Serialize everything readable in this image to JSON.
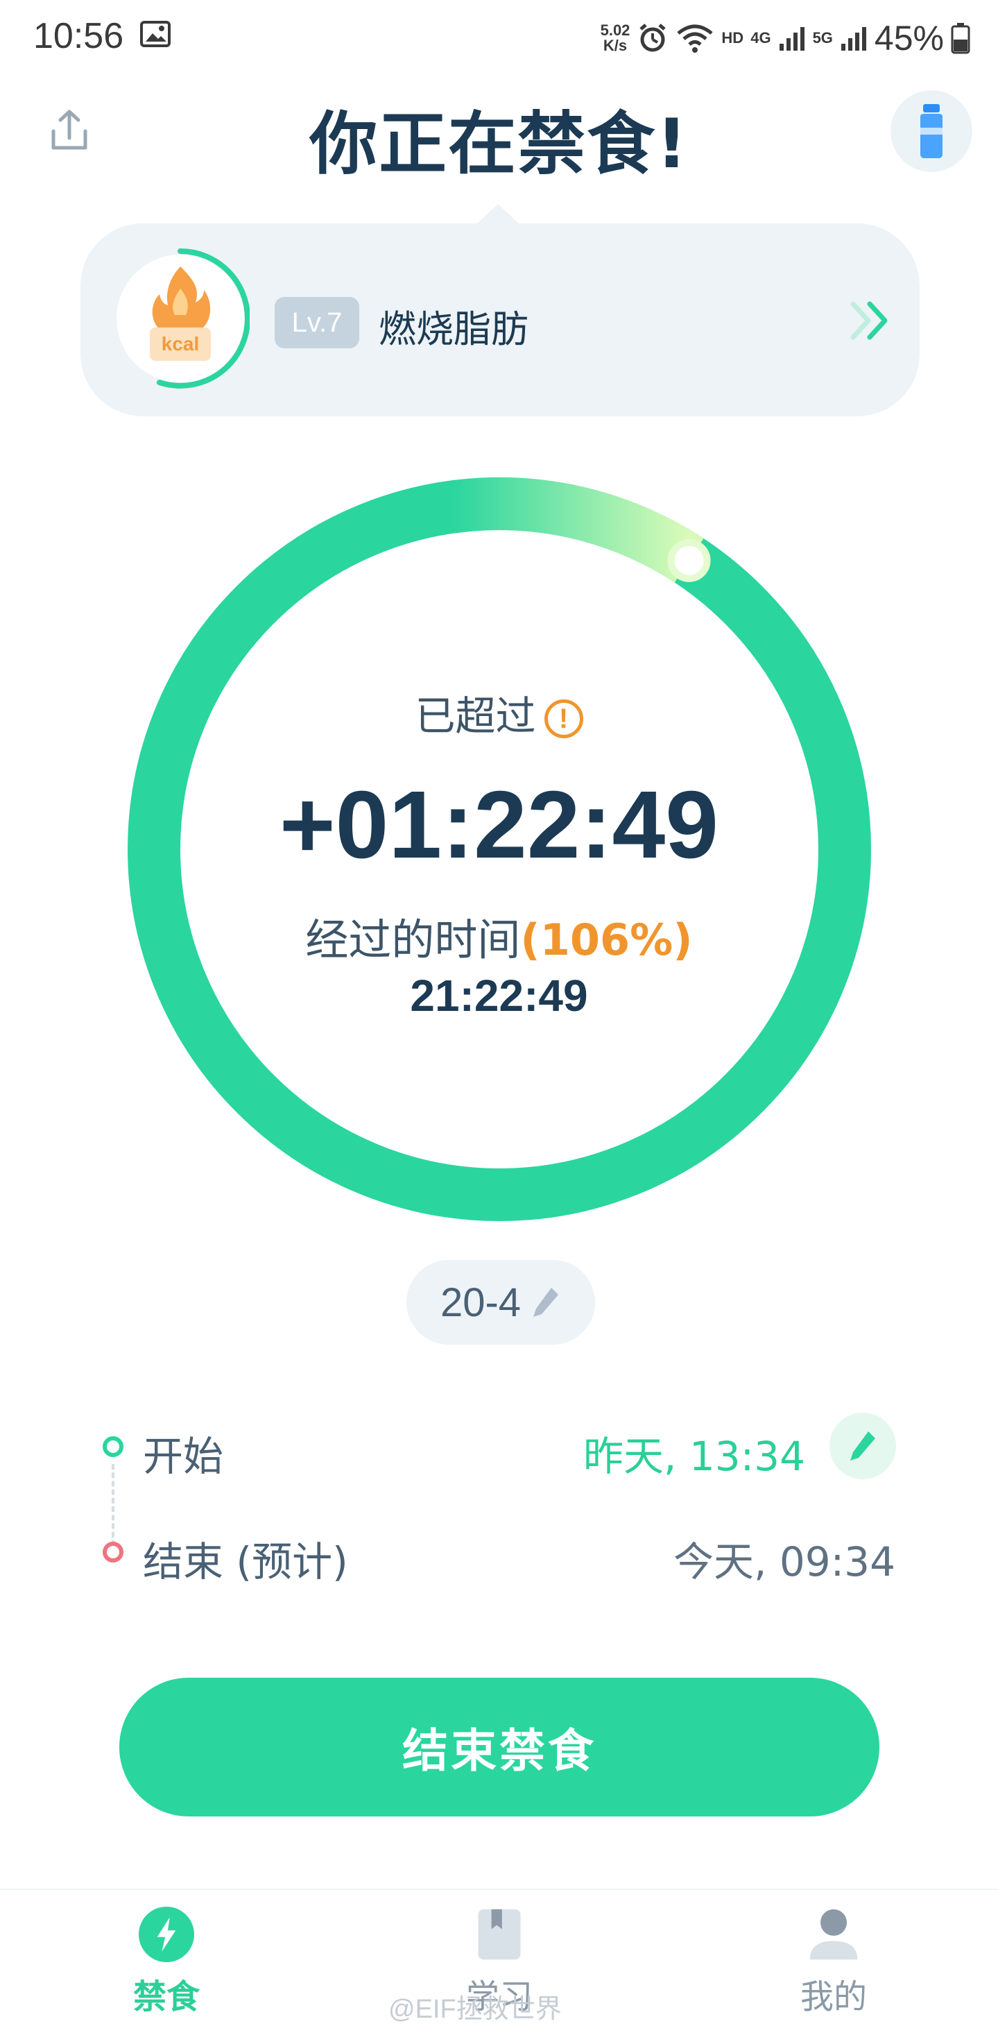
{
  "status_bar": {
    "time": "10:56",
    "speed_value": "5.02",
    "speed_unit": "K/s",
    "hd": "HD",
    "net_4g": "4G",
    "net_5g": "5G",
    "battery": "45%"
  },
  "header": {
    "title": "你正在禁食!"
  },
  "level": {
    "badge": "Lv.7",
    "name": "燃烧脂肪",
    "icon_text": "kcal",
    "progress_fraction": 0.55
  },
  "timer": {
    "overtime_label": "已超过",
    "overtime_value": "+01:22:49",
    "elapsed_label": "经过的时间",
    "elapsed_percent": "(106%)",
    "elapsed_value": "21:22:49",
    "progress_fraction": 1.06
  },
  "plan": {
    "label": "20-4"
  },
  "schedule": {
    "start_label": "开始",
    "start_value": "昨天, 13:34",
    "end_label": "结束 (预计)",
    "end_value": "今天, 09:34"
  },
  "actions": {
    "end_fast": "结束禁食"
  },
  "nav": {
    "fasting": "禁食",
    "learn": "学习",
    "me": "我的"
  },
  "watermark": "@EIF拯救世界",
  "colors": {
    "accent_green": "#2ad59e",
    "title_navy": "#1c3a53",
    "warning_orange": "#f0952d",
    "end_dot_red": "#f0747d"
  }
}
